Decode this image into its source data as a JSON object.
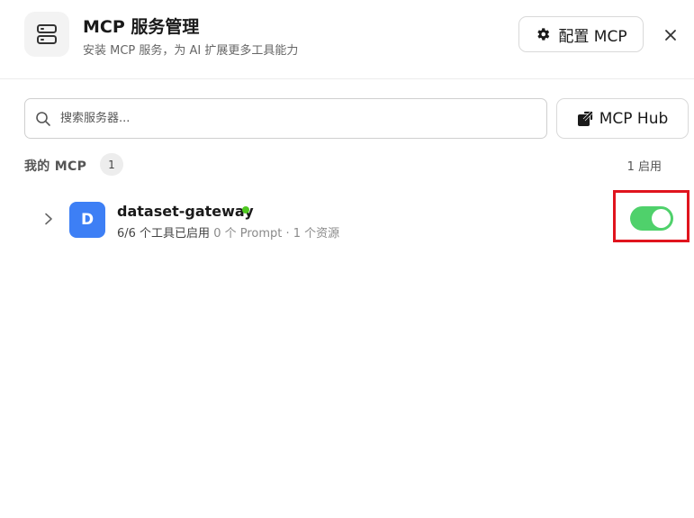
{
  "header": {
    "title": "MCP 服务管理",
    "subtitle": "安装 MCP 服务，为 AI 扩展更多工具能力",
    "config_button_label": "配置 MCP",
    "icons": {
      "app": "server-stack-icon",
      "config": "gear-icon",
      "close": "close-icon"
    }
  },
  "search": {
    "placeholder": "搜索服务器...",
    "value": "",
    "icon": "search-icon"
  },
  "hub_button": {
    "label": "MCP Hub",
    "icon": "external-link-icon"
  },
  "section": {
    "label": "我的 MCP",
    "count": "1",
    "enabled_summary": "1 启用"
  },
  "servers": [
    {
      "avatar_letter": "D",
      "name": "dataset-gateway",
      "status": "online",
      "tools_text": "6/6 个工具已启用",
      "extra_text": "0 个 Prompt · 1 个资源",
      "enabled": true,
      "icons": {
        "expand": "chevron-right-icon"
      }
    }
  ],
  "colors": {
    "avatar": "#3d7ff5",
    "status_dot": "#4ec820",
    "toggle_on": "#4fd16b",
    "highlight": "#e0141e"
  }
}
